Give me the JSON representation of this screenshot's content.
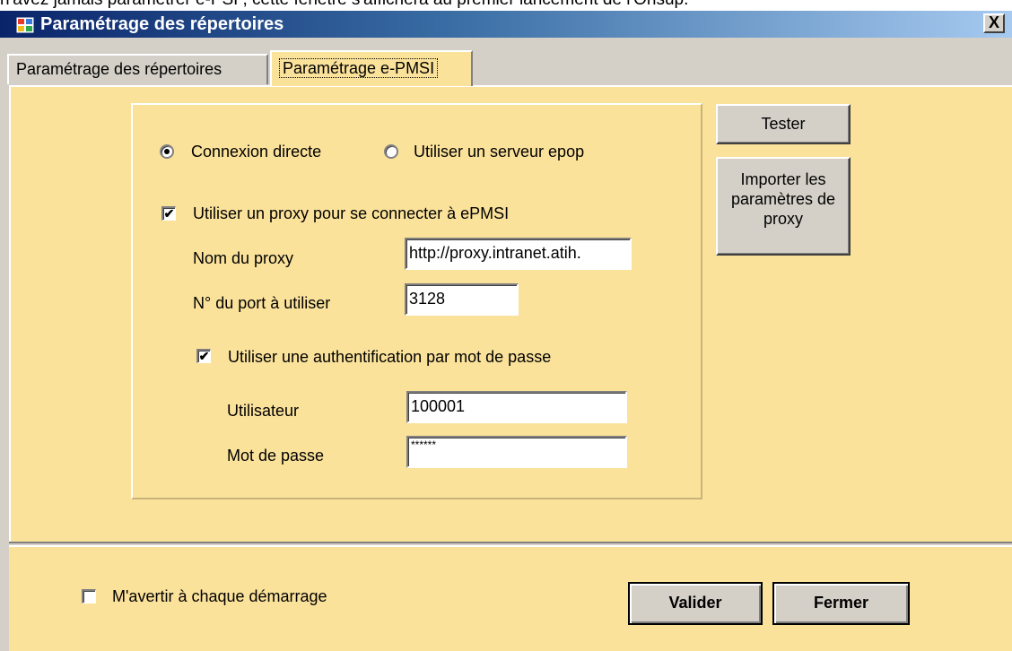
{
  "background_caption": "n'avez jamais paramétrer e-PSP, cette fenêtre s'affichera au premier lancement de l'Onsup.",
  "window": {
    "title": "Paramétrage des répertoires",
    "close_glyph": "X",
    "icon": "app-window-icon"
  },
  "tabs": [
    {
      "label": "Paramétrage des répertoires",
      "selected": false
    },
    {
      "label": "Paramétrage e-PMSI",
      "selected": true
    }
  ],
  "connection": {
    "direct_label": "Connexion directe",
    "direct_selected": true,
    "epop_label": "Utiliser un serveur epop",
    "epop_selected": false
  },
  "proxy": {
    "use_proxy_label": "Utiliser un proxy pour se connecter à ePMSI",
    "use_proxy_checked": true,
    "name_label": "Nom du proxy",
    "name_value": "http://proxy.intranet.atih.",
    "port_label": "N° du port à utiliser",
    "port_value": "3128"
  },
  "auth": {
    "use_auth_label": "Utiliser une authentification par mot de passe",
    "use_auth_checked": true,
    "user_label": "Utilisateur",
    "user_value": "100001",
    "password_label": "Mot de passe",
    "password_value": "******"
  },
  "buttons": {
    "test_label": "Tester",
    "import_label": "Importer les paramètres de proxy",
    "validate_label": "Valider",
    "close_label": "Fermer"
  },
  "footer": {
    "warn_label": "M'avertir à chaque démarrage",
    "warn_checked": false
  },
  "check_glyph": "✔",
  "colors": {
    "panel": "#fbe29b",
    "title_start": "#0a246a",
    "title_end": "#a6caf0",
    "chrome": "#d4d0c8"
  }
}
